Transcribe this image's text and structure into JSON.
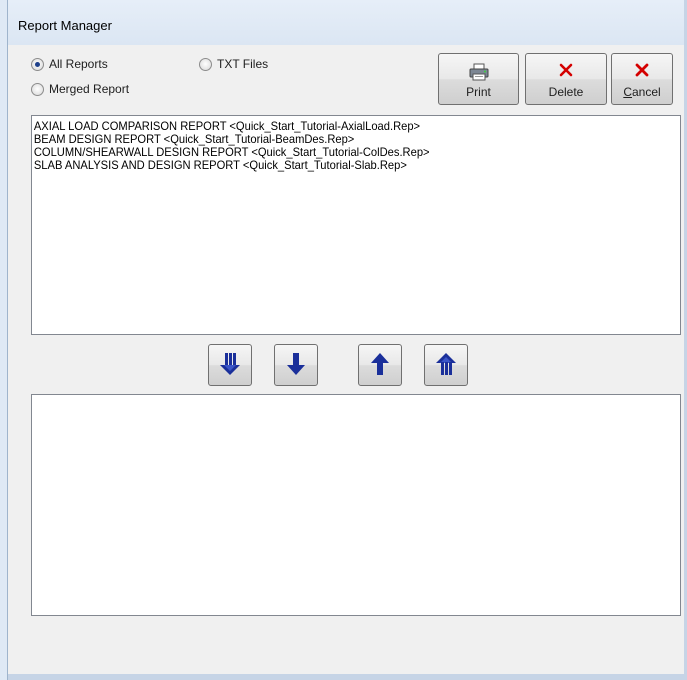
{
  "window": {
    "title": "Report Manager"
  },
  "filters": {
    "all_reports": {
      "label": "All Reports",
      "checked": true
    },
    "merged_report": {
      "label": "Merged Report",
      "checked": false
    },
    "txt_files": {
      "label": "TXT Files",
      "checked": false
    }
  },
  "toolbar": {
    "print": {
      "label": "Print",
      "icon": "printer-icon"
    },
    "delete": {
      "label": "Delete",
      "icon": "red-x-icon"
    },
    "cancel": {
      "label": "Cancel",
      "icon": "red-x-icon",
      "mnemonic": "C"
    }
  },
  "available_reports": [
    "AXIAL LOAD COMPARISON REPORT  <Quick_Start_Tutorial-AxialLoad.Rep>",
    "BEAM DESIGN REPORT  <Quick_Start_Tutorial-BeamDes.Rep>",
    "COLUMN/SHEARWALL DESIGN REPORT  <Quick_Start_Tutorial-ColDes.Rep>",
    "SLAB ANALYSIS AND DESIGN REPORT  <Quick_Start_Tutorial-Slab.Rep>"
  ],
  "transfer_buttons": [
    {
      "name": "move-all-down-button",
      "icon": "double-arrow-down-icon"
    },
    {
      "name": "move-down-button",
      "icon": "arrow-down-icon"
    },
    {
      "name": "move-up-button",
      "icon": "arrow-up-icon"
    },
    {
      "name": "move-all-up-button",
      "icon": "double-arrow-up-icon"
    }
  ],
  "selected_reports": [],
  "colors": {
    "arrow": "#1a2f9a",
    "delete_x": "#d40000",
    "selection_dot": "#1d3f8a"
  }
}
